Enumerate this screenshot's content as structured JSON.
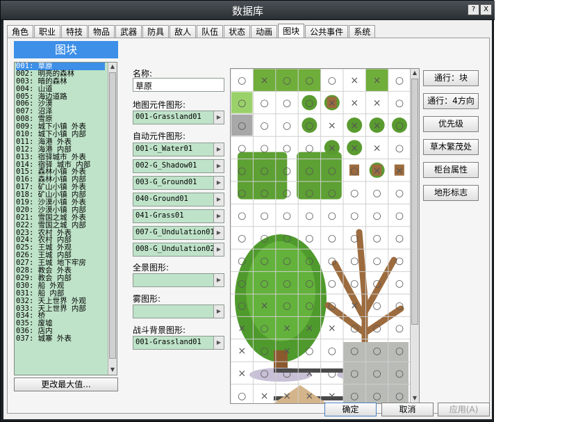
{
  "window": {
    "title": "数据库",
    "help_label": "?",
    "close_label": "X"
  },
  "tabs": [
    "角色",
    "职业",
    "特技",
    "物品",
    "武器",
    "防具",
    "敌人",
    "队伍",
    "状态",
    "动画",
    "图块",
    "公共事件",
    "系统"
  ],
  "active_tab": 10,
  "sidebar": {
    "header": "图块",
    "items": [
      "001: 草原",
      "002: 明亮的森林",
      "003: 暗的森林",
      "004: 山道",
      "005: 海边道路",
      "006: 沙漠",
      "007: 沼泽",
      "008: 雪原",
      "009: 城下小镇 外表",
      "010: 城下小镇 内部",
      "011: 海港 外表",
      "012: 海港 内部",
      "013: 宿驿城市 外表",
      "014: 宿驿 城市 内部",
      "015: 森林小镇 外表",
      "016: 森林小镇 内部",
      "017: 矿山小镇 外表",
      "018: 矿山小镇 内部",
      "019: 沙漠小镇 外表",
      "020: 沙漠小镇 内部",
      "021: 雪国之城 外表",
      "022: 雪国之城 内部",
      "023: 农村 外表",
      "024: 农村 内部",
      "025: 王城 外观",
      "026: 王城 内部",
      "027: 王城 地下牢房",
      "028: 教会 外表",
      "029: 教会 内部",
      "030: 船 外观",
      "031: 船 内部",
      "032: 天上世界 外观",
      "033: 天上世界 内部",
      "034: 桥",
      "035: 废墟",
      "036: 店内",
      "037: 城寨 外表"
    ],
    "selected_index": 0,
    "change_max_label": "更改最大值..."
  },
  "form": {
    "name_label": "名称:",
    "name_value": "草原",
    "tileset_label": "地图元件图形:",
    "tileset_value": "001-Grassland01",
    "autotile_label": "自动元件图形:",
    "autotiles": [
      "001-G_Water01",
      "002-G_Shadow01",
      "003-G_Ground01",
      "040-Ground01",
      "041-Grass01",
      "007-G_Undulation01",
      "008-G_Undulation02"
    ],
    "panorama_label": "全景图形:",
    "panorama_value": "",
    "fog_label": "雾图形:",
    "fog_value": "",
    "battleback_label": "战斗背景图形:",
    "battleback_value": "001-Grassland01"
  },
  "tile_buttons": [
    "通行：块",
    "通行：4方向",
    "优先级",
    "草木繁茂处",
    "柜台属性",
    "地形标志"
  ],
  "tile_marks": {
    "passable": "○",
    "blocked": "×"
  },
  "footer": {
    "ok": "确定",
    "cancel": "取消",
    "apply": "应用(A)"
  },
  "colors": {
    "accent": "#3d8fe8",
    "field_bg": "#bfe3c9",
    "grass": "#6fae3a",
    "trunk": "#9c6b3e"
  }
}
